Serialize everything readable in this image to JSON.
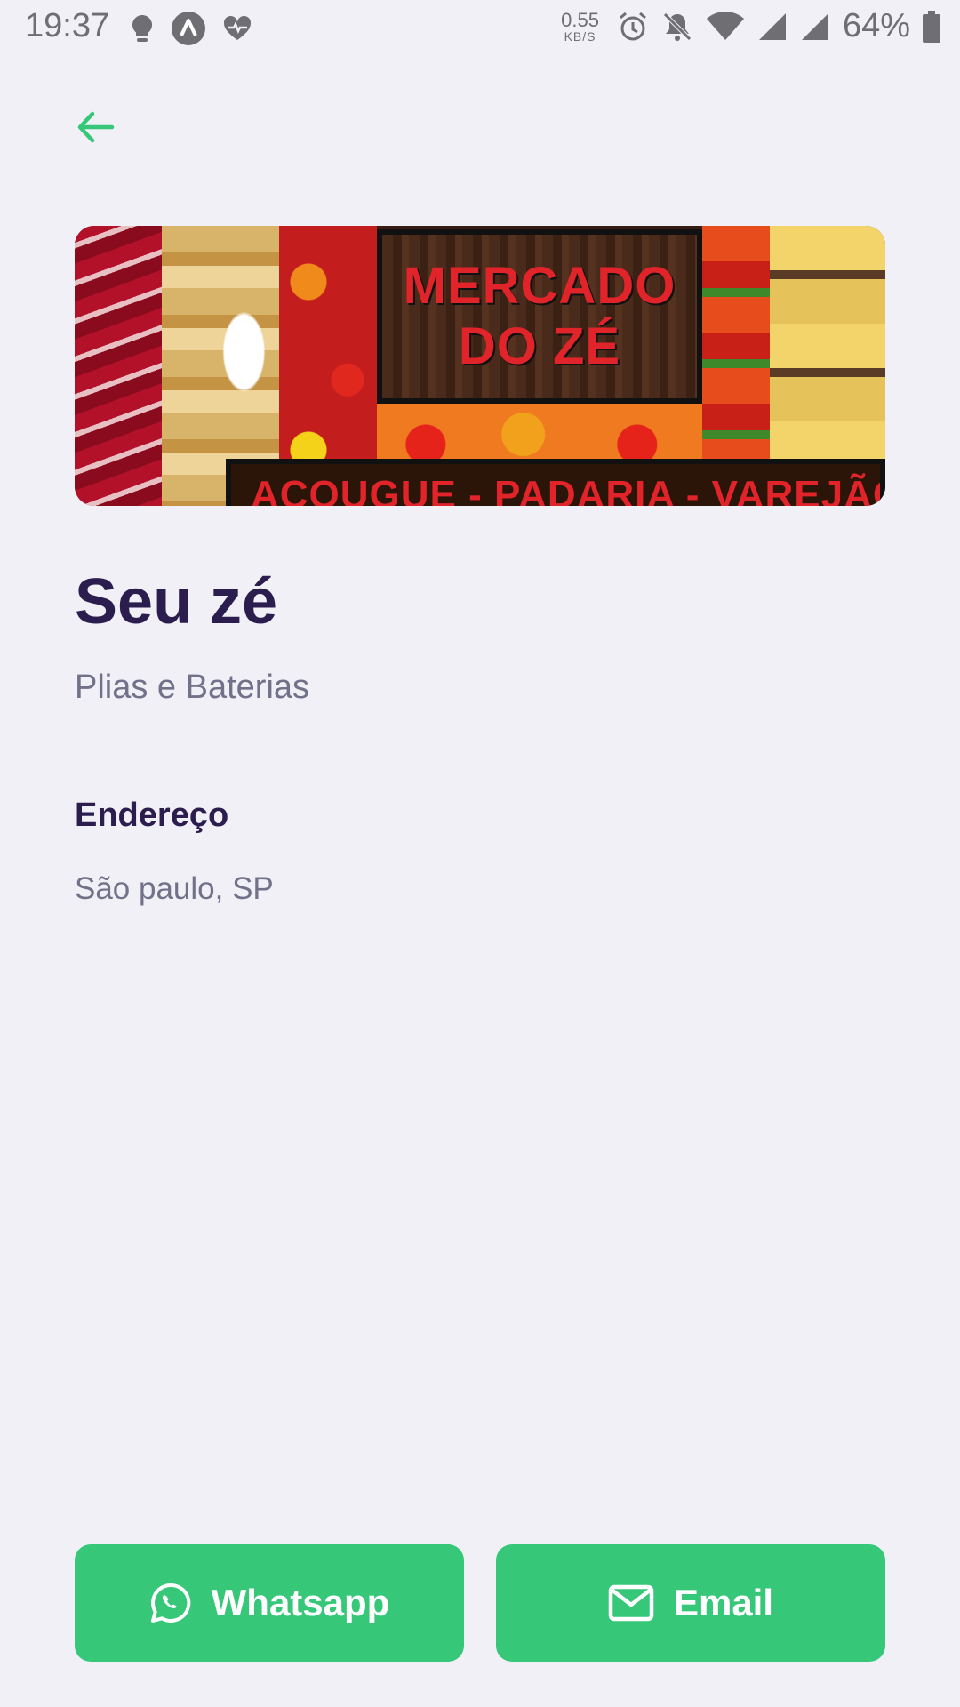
{
  "status_bar": {
    "time": "19:37",
    "speed_value": "0.55",
    "speed_unit": "KB/S",
    "battery": "64%",
    "icons": [
      "lightbulb-icon",
      "app-a-icon",
      "heart-pulse-icon",
      "alarm-icon",
      "bell-off-icon",
      "wifi-icon",
      "signal-icon",
      "signal-icon",
      "battery-icon"
    ]
  },
  "nav": {
    "back_icon": "arrow-left-icon",
    "accent": "#36c878"
  },
  "banner": {
    "sign_line1": "MERCADO",
    "sign_line2": "DO ZÉ",
    "footer_text": "ACOUGUE - PADARIA - VAREJÃO"
  },
  "store": {
    "name": "Seu zé",
    "category": "Plias e Baterias",
    "address_label": "Endereço",
    "address": "São paulo, SP"
  },
  "actions": {
    "whatsapp_label": "Whatsapp",
    "whatsapp_icon": "whatsapp-icon",
    "email_label": "Email",
    "email_icon": "mail-icon",
    "button_color": "#36c878"
  },
  "colors": {
    "background": "#f0f0f6",
    "title": "#2b1d4e",
    "muted": "#71718a"
  }
}
